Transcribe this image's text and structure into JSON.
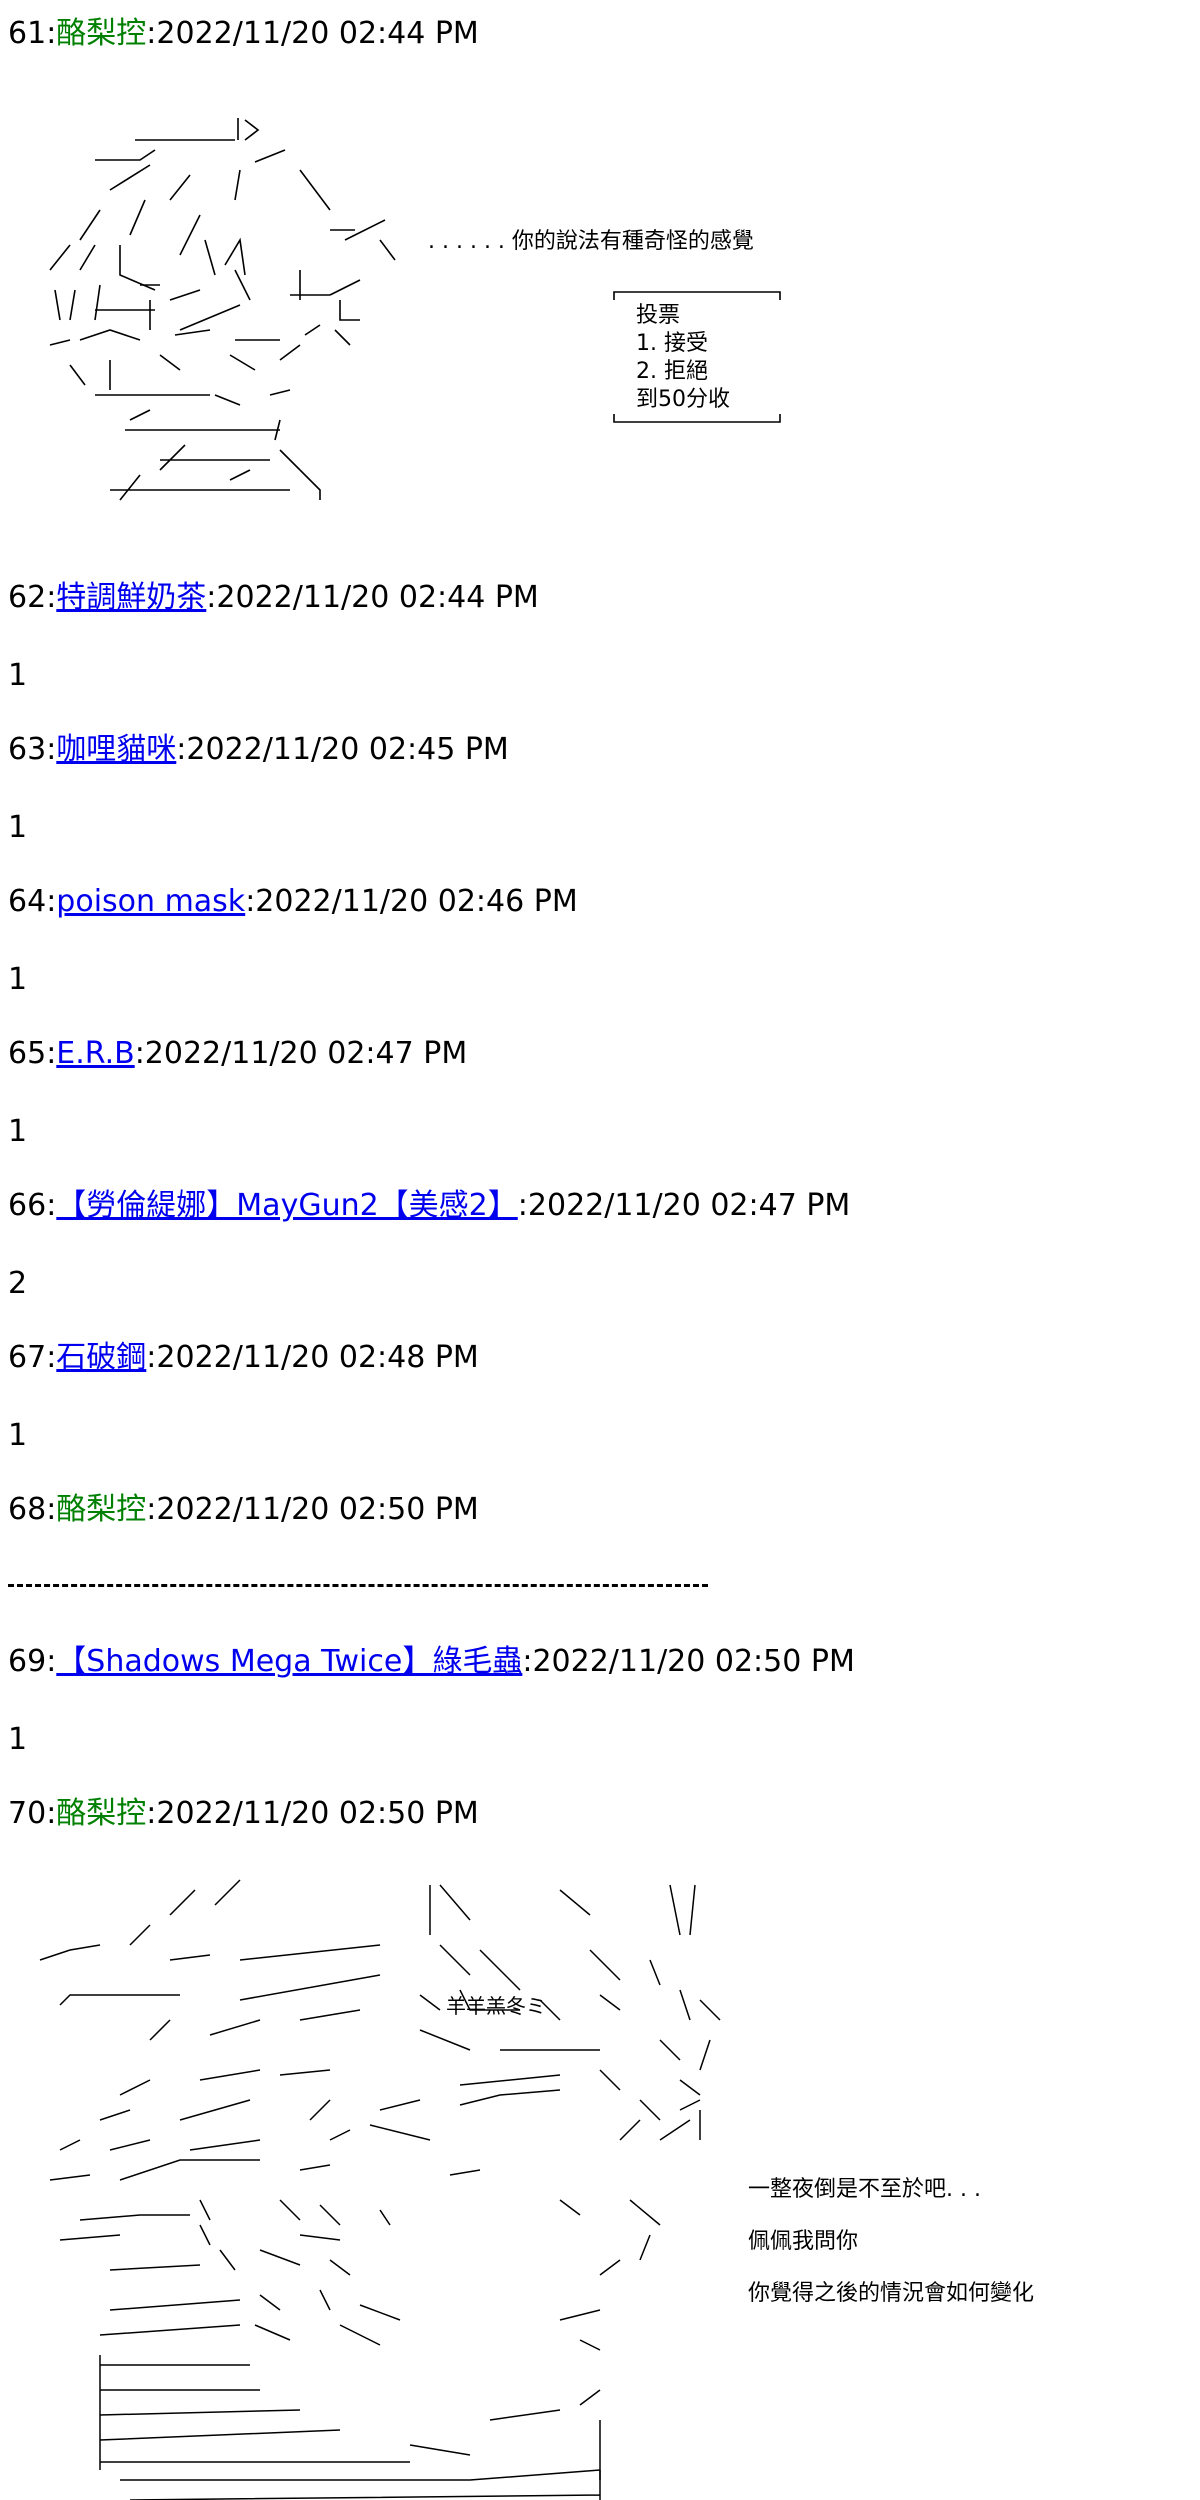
{
  "posts": [
    {
      "num": "61",
      "name": "酪梨控",
      "linked": false,
      "time": "2022/11/20 02:44 PM",
      "body": ""
    },
    {
      "num": "62",
      "name": "特調鮮奶茶",
      "linked": true,
      "time": "2022/11/20 02:44 PM",
      "body": "1"
    },
    {
      "num": "63",
      "name": "咖哩貓咪",
      "linked": true,
      "time": "2022/11/20 02:45 PM",
      "body": "1"
    },
    {
      "num": "64",
      "name": "poison mask",
      "linked": true,
      "time": "2022/11/20 02:46 PM",
      "body": "1"
    },
    {
      "num": "65",
      "name": "E.R.B",
      "linked": true,
      "time": "2022/11/20 02:47 PM",
      "body": "1"
    },
    {
      "num": "66",
      "name": "【勞倫緹娜】MayGun2【美感2】",
      "linked": true,
      "time": "2022/11/20 02:47 PM",
      "body": "2"
    },
    {
      "num": "67",
      "name": "石破鋼",
      "linked": true,
      "time": "2022/11/20 02:48 PM",
      "body": "1"
    },
    {
      "num": "68",
      "name": "酪梨控",
      "linked": false,
      "time": "2022/11/20 02:50 PM",
      "body": ""
    },
    {
      "num": "69",
      "name": "【Shadows Mega Twice】綠毛蟲",
      "linked": true,
      "time": "2022/11/20 02:50 PM",
      "body": "1"
    },
    {
      "num": "70",
      "name": "酪梨控",
      "linked": false,
      "time": "2022/11/20 02:50 PM",
      "body": ""
    }
  ],
  "separator": ":",
  "aa1": {
    "dialogue": ". . . . . . 你的說法有種奇怪的感覺",
    "vote": {
      "title": "投票",
      "option1": "1. 接受",
      "option2": "2. 拒絕",
      "deadline": "到50分收"
    }
  },
  "aa2": {
    "lines": [
      "一整夜倒是不至於吧. . .",
      "佩佩我問你",
      "你覺得之後的情況會如何變化"
    ],
    "inner_text": "羊羊羔冬ミ"
  },
  "colors": {
    "link": "#0000ee",
    "plain_name": "#008000",
    "text": "#000000"
  }
}
